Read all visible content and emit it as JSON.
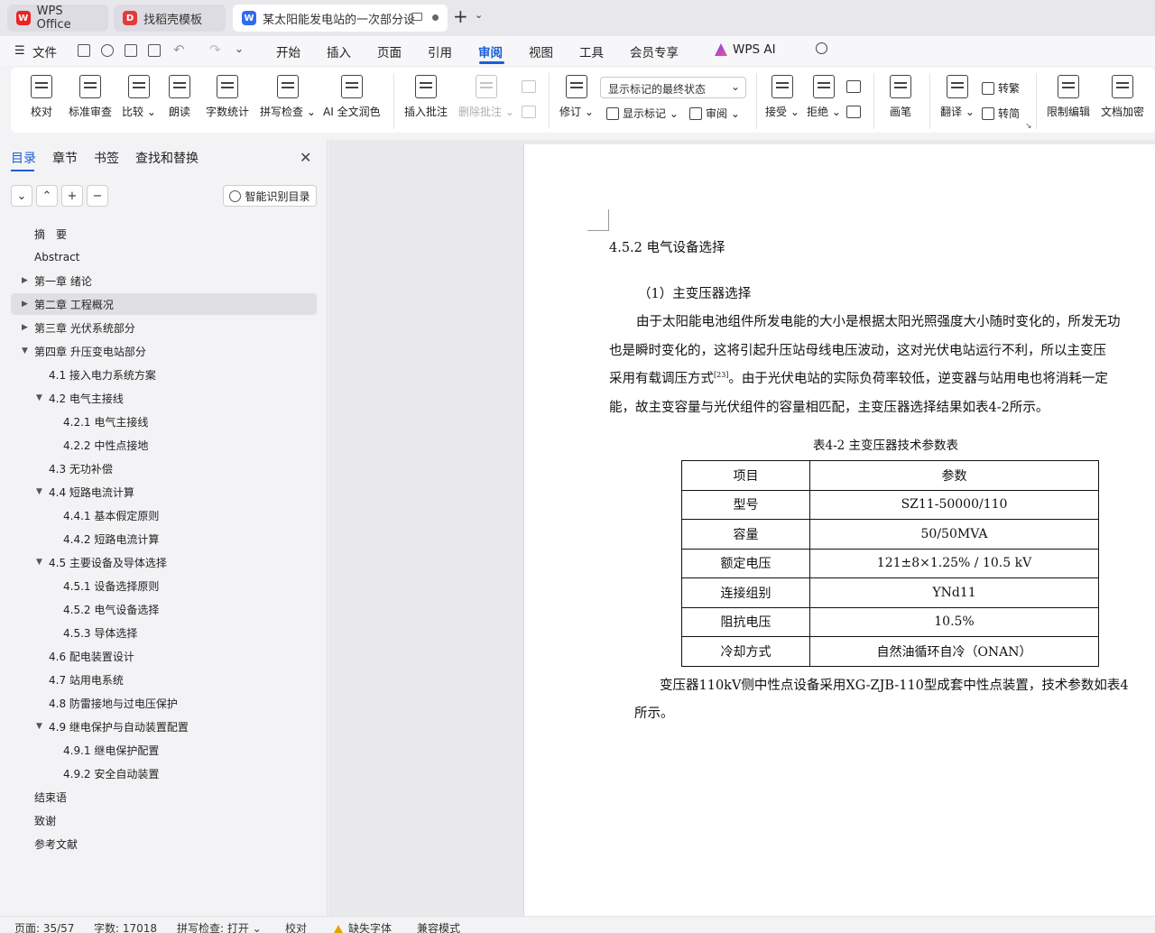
{
  "tabs": [
    {
      "label": "WPS Office",
      "icon": "wps-logo-icon"
    },
    {
      "label": "找稻壳模板",
      "icon": "docer-icon"
    },
    {
      "label": "某太阳能发电站的一次部分设",
      "icon": "word-doc-icon"
    }
  ],
  "quick_menu": {
    "file_label": "文件"
  },
  "menu": [
    {
      "label": "开始"
    },
    {
      "label": "插入"
    },
    {
      "label": "页面"
    },
    {
      "label": "引用"
    },
    {
      "label": "审阅",
      "active": true
    },
    {
      "label": "视图"
    },
    {
      "label": "工具"
    },
    {
      "label": "会员专享"
    },
    {
      "label": "WPS AI"
    }
  ],
  "ribbon": {
    "proofread": "校对",
    "std_review": "标准审查",
    "compare": "比较",
    "read_aloud": "朗读",
    "word_count": "字数统计",
    "spell_check": "拼写检查",
    "ai_polish": "AI 全文润色",
    "insert_comment": "插入批注",
    "delete_comment": "删除批注",
    "track_changes": "修订",
    "markup_dropdown": "显示标记的最终状态",
    "show_markup": "显示标记",
    "review_pane": "审阅",
    "accept": "接受",
    "reject": "拒绝",
    "pen": "画笔",
    "translate": "翻译",
    "to_traditional": "转繁",
    "to_simplified": "转简",
    "restrict_edit": "限制编辑",
    "doc_encrypt": "文档加密"
  },
  "nav": {
    "tabs": [
      "目录",
      "章节",
      "书签",
      "查找和替换"
    ],
    "smart_toc": "智能识别目录",
    "items": [
      {
        "label": "摘　要",
        "level": 0,
        "arrow": ""
      },
      {
        "label": "Abstract",
        "level": 0,
        "arrow": ""
      },
      {
        "label": "第一章  绪论",
        "level": 0,
        "arrow": "collapsed"
      },
      {
        "label": "第二章  工程概况",
        "level": 0,
        "arrow": "collapsed",
        "selected": true
      },
      {
        "label": "第三章  光伏系统部分",
        "level": 0,
        "arrow": "collapsed"
      },
      {
        "label": "第四章  升压变电站部分",
        "level": 0,
        "arrow": "expanded"
      },
      {
        "label": "4.1  接入电力系统方案",
        "level": 1,
        "arrow": ""
      },
      {
        "label": "4.2  电气主接线",
        "level": 1,
        "arrow": "expanded"
      },
      {
        "label": "4.2.1  电气主接线",
        "level": 2,
        "arrow": ""
      },
      {
        "label": "4.2.2  中性点接地",
        "level": 2,
        "arrow": ""
      },
      {
        "label": "4.3  无功补偿",
        "level": 1,
        "arrow": ""
      },
      {
        "label": "4.4  短路电流计算",
        "level": 1,
        "arrow": "expanded"
      },
      {
        "label": "4.4.1 基本假定原则",
        "level": 2,
        "arrow": ""
      },
      {
        "label": "4.4.2  短路电流计算",
        "level": 2,
        "arrow": ""
      },
      {
        "label": "4.5  主要设备及导体选择",
        "level": 1,
        "arrow": "expanded"
      },
      {
        "label": "4.5.1  设备选择原则",
        "level": 2,
        "arrow": ""
      },
      {
        "label": "4.5.2  电气设备选择",
        "level": 2,
        "arrow": ""
      },
      {
        "label": "4.5.3  导体选择",
        "level": 2,
        "arrow": ""
      },
      {
        "label": "4.6  配电装置设计",
        "level": 1,
        "arrow": ""
      },
      {
        "label": "4.7  站用电系统",
        "level": 1,
        "arrow": ""
      },
      {
        "label": "4.8  防雷接地与过电压保护",
        "level": 1,
        "arrow": ""
      },
      {
        "label": "4.9  继电保护与自动装置配置",
        "level": 1,
        "arrow": "expanded"
      },
      {
        "label": "4.9.1  继电保护配置",
        "level": 2,
        "arrow": ""
      },
      {
        "label": "4.9.2  安全自动装置",
        "level": 2,
        "arrow": ""
      },
      {
        "label": "结束语",
        "level": 0,
        "arrow": ""
      },
      {
        "label": "致谢",
        "level": 0,
        "arrow": ""
      },
      {
        "label": "参考文献",
        "level": 0,
        "arrow": ""
      }
    ]
  },
  "doc": {
    "heading": "4.5.2  电气设备选择",
    "subheading": "（1）主变压器选择",
    "para_lines": [
      "由于太阳能电池组件所发电能的大小是根据太阳光照强度大小随时变化的，所发无功",
      "也是瞬时变化的，这将引起升压站母线电压波动，这对光伏电站运行不利，所以主变压",
      "采用有载调压方式",
      "。由于光伏电站的实际负荷率较低，逆变器与站用电也将消耗一定",
      "能，故主变容量与光伏组件的容量相匹配，主变压器选择结果如表4-2所示。"
    ],
    "citation": "[23]",
    "table_caption": "表4-2  主变压器技术参数表",
    "table_header": [
      "项目",
      "参数"
    ],
    "table_rows": [
      [
        "型号",
        "SZ11-50000/110"
      ],
      [
        "容量",
        "50/50MVA"
      ],
      [
        "额定电压",
        "121±8×1.25% / 10.5 kV"
      ],
      [
        "连接组别",
        "YNd11"
      ],
      [
        "阻抗电压",
        "10.5%"
      ],
      [
        "冷却方式",
        "自然油循环自冷（ONAN）"
      ]
    ],
    "para2_line1": "变压器110kV侧中性点设备采用XG-ZJB-110型成套中性点装置，技术参数如表4",
    "para2_line2": "所示。"
  },
  "status": {
    "page": "页面: 35/57",
    "words": "字数: 17018",
    "spell": "拼写检查: 打开",
    "proof": "校对",
    "missing_font": "缺失字体",
    "compat": "兼容模式"
  }
}
